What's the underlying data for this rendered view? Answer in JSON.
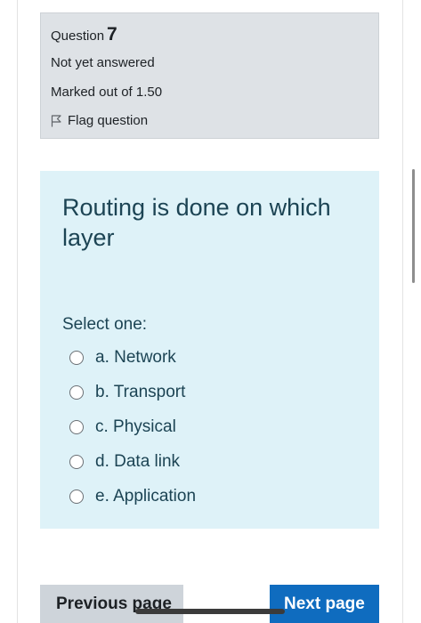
{
  "question": {
    "label": "Question",
    "number": "7",
    "state": "Not yet answered",
    "grade": "Marked out of 1.50",
    "flag_label": "Flag question"
  },
  "formulation": {
    "text": "Routing is done on which layer",
    "prompt": "Select one:",
    "answers": [
      {
        "label": "a. Network",
        "selected": false
      },
      {
        "label": "b. Transport",
        "selected": false
      },
      {
        "label": "c. Physical",
        "selected": false
      },
      {
        "label": "d. Data link",
        "selected": false
      },
      {
        "label": "e. Application",
        "selected": false
      }
    ]
  },
  "navigation": {
    "prev_label": "Previous page",
    "next_label": "Next page"
  },
  "colors": {
    "info_bg": "#dee2e6",
    "formulation_bg": "#def2f8",
    "primary": "#0f6cbf",
    "secondary": "#ced4da"
  }
}
